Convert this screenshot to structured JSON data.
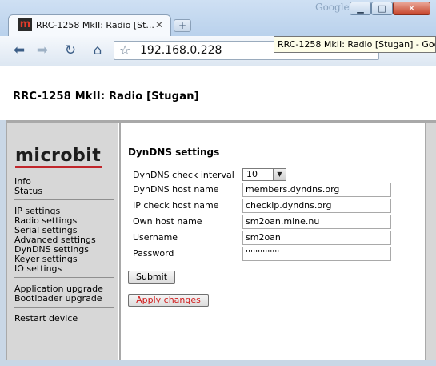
{
  "browser": {
    "google_mark": "Google",
    "tab_title": "RRC-1258 MkII: Radio [St...",
    "favicon_letter": "m",
    "address": "192.168.0.228",
    "tooltip": "RRC-1258 MkII: Radio [Stugan] - Goog"
  },
  "page": {
    "title": "RRC-1258 MkII: Radio [Stugan]"
  },
  "sidebar": {
    "logo": "microbit",
    "groups": [
      [
        "Info",
        "Status"
      ],
      [
        "IP settings",
        "Radio settings",
        "Serial settings",
        "Advanced settings",
        "DynDNS settings",
        "Keyer settings",
        "IO settings"
      ],
      [
        "Application upgrade",
        "Bootloader upgrade"
      ],
      [
        "Restart device"
      ]
    ]
  },
  "form": {
    "heading": "DynDNS settings",
    "check_interval_label": "DynDNS check interval",
    "check_interval_value": "10",
    "host_name_label": "DynDNS host name",
    "host_name_value": "members.dyndns.org",
    "ip_check_label": "IP check host name",
    "ip_check_value": "checkip.dyndns.org",
    "own_host_label": "Own host name",
    "own_host_value": "sm2oan.mine.nu",
    "username_label": "Username",
    "username_value": "sm2oan",
    "password_label": "Password",
    "password_value": "''''''''''''''",
    "submit_label": "Submit",
    "apply_label": "Apply changes"
  },
  "colors": {
    "brand_red": "#c0262b",
    "apply_text": "#d11a1a",
    "sidebar_bg": "#d7d7d7"
  }
}
